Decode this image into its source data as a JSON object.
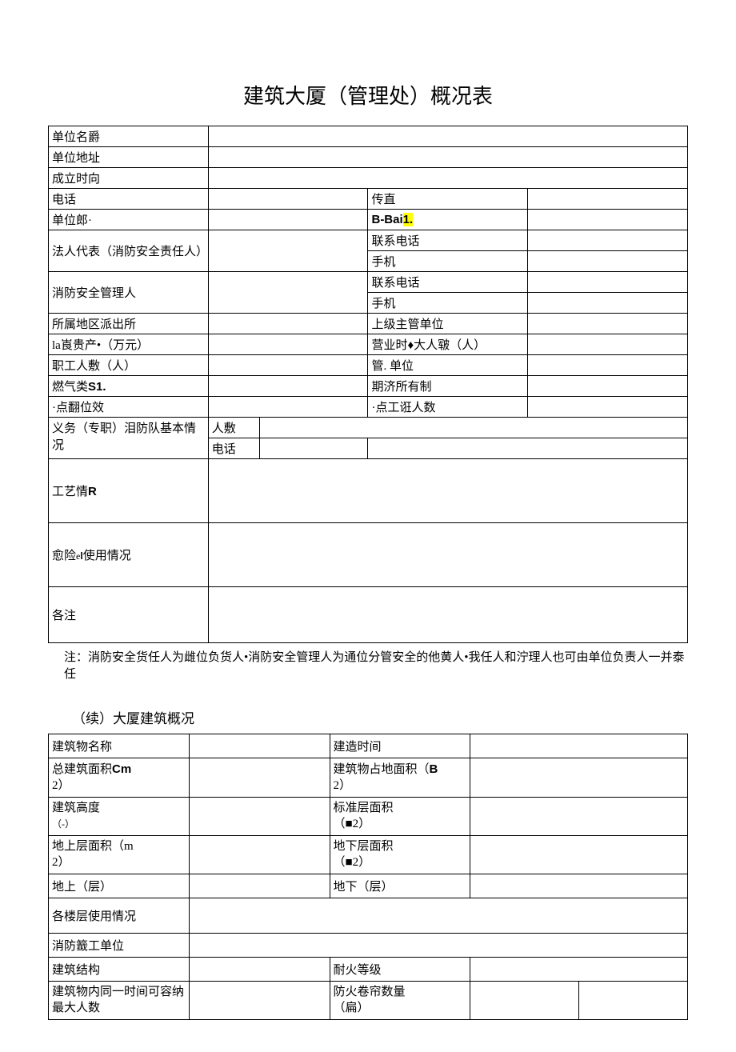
{
  "title": "建筑大厦（管理处）概况表",
  "t1": {
    "r1_l": "单位名爵",
    "r2_l": "单位地址",
    "r3_l": "成立时向",
    "r4_l": "电话",
    "r4_r": "传直",
    "r5_l": "单位郎·",
    "r5_r_prefix": "B-Bai",
    "r5_r_hl": "1.",
    "r6_l": "法人代表（消防安全责任人）",
    "r6_r1": "联系电话",
    "r6_r2": "手机",
    "r7_l": "消防安全管理人",
    "r7_r1": "联系电话",
    "r7_r2": "手机",
    "r8_l": "所属地区派出所",
    "r8_r": "上级主管单位",
    "r9_l_pre": "la崀贵产•（万元）",
    "r9_r": "营业时♦大人皲（人）",
    "r10_l": "职工人敷（人）",
    "r10_r": "管. 单位",
    "r11_l_pre": "燃气类",
    "r11_l_bold": "S1.",
    "r11_r": "期济所有制",
    "r12_l": "·点翻位效",
    "r12_r": "·点工诳人数",
    "r13_l": "义务（专职）泪防队基本情况",
    "r13_m1": "人敷",
    "r13_m2": "电话",
    "r14_l": "工艺情",
    "r14_l_suffix": "R",
    "r15_l_pre": "愈险",
    "r15_l_mid": "e",
    "r15_l_post": "l使用情况",
    "r16_l": "各注"
  },
  "note": "注：消防安全货任人为雌位负货人•消防安全管理人为通位分管安全的他黄人•我任人和泞理人也可由单位负责人一并泰任",
  "subtitle": "（续）大厦建筑概况",
  "t2": {
    "r1_l": "建筑物名称",
    "r1_r": "建造时间",
    "r2_l_pre": "总建筑面积",
    "r2_l_bold": "Cm",
    "r2_l_post": "2）",
    "r2_r_pre": "建筑物占地面积（",
    "r2_r_bold": "B",
    "r2_r_post": "2）",
    "r3_l": "建筑高度",
    "r3_l2": "（-）",
    "r3_r": "标准层面积",
    "r3_r2": "（■2）",
    "r4_l": "地上层面积（m",
    "r4_l2": "2）",
    "r4_r": "地下层面积",
    "r4_r2": "（■2）",
    "r5_l": "地上（层）",
    "r5_r": "地下（层）",
    "r6_l": "各楼层使用情况",
    "r7_l": "消防籖工单位",
    "r8_l": "建筑结构",
    "r8_r": "耐火等级",
    "r9_l": "建筑物内同一时间可容纳最大人数",
    "r9_r": "防火卷帘数量",
    "r9_r2": "（扁）"
  }
}
